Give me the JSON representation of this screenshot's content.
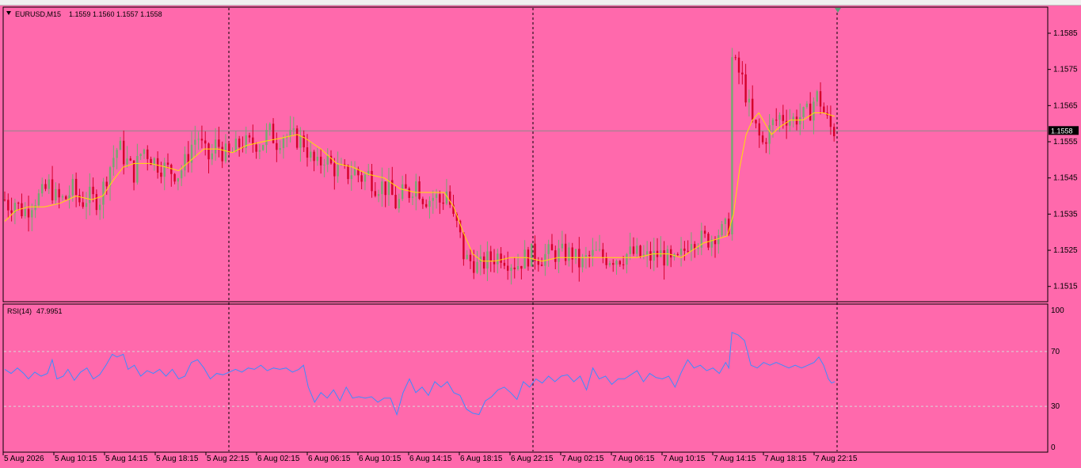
{
  "header": {
    "symbol_label": "EURUSD,M15",
    "ohlc_label": "1.1559 1.1560 1.1557 1.1558",
    "menu_arrow_icon": "triangle-down-icon"
  },
  "colors": {
    "background": "#ff69ac",
    "bull": "#74a970",
    "bear": "#d4002a",
    "ma": "#ffe100",
    "rsi": "#3d8bff",
    "grid": "#000000",
    "bid_line": "#8a8a8a",
    "bid_label_bg": "#000000",
    "bid_label_text": "#ffffff"
  },
  "chart_data": [
    {
      "type": "candlestick",
      "symbol": "EURUSD",
      "timeframe": "M15",
      "ohlc_current": {
        "open": 1.1559,
        "high": 1.156,
        "low": 1.1557,
        "close": 1.1558
      },
      "current_price_label": "1.1558",
      "ylim": [
        1.1511,
        1.1592
      ],
      "y_ticks": [
        "1.1585",
        "1.1575",
        "1.1565",
        "1.1555",
        "1.1545",
        "1.1535",
        "1.1525",
        "1.1515"
      ],
      "close_trace": [
        [
          0,
          1.1539
        ],
        [
          6,
          1.1537
        ],
        [
          12,
          1.1539
        ],
        [
          20,
          1.1536
        ],
        [
          28,
          1.1536
        ],
        [
          36,
          1.1539
        ],
        [
          46,
          1.154
        ],
        [
          56,
          1.1543
        ],
        [
          66,
          1.1539
        ],
        [
          76,
          1.1539
        ],
        [
          86,
          1.1542
        ],
        [
          96,
          1.1538
        ],
        [
          106,
          1.154
        ],
        [
          112,
          1.1539
        ],
        [
          120,
          1.1539
        ],
        [
          128,
          1.1545
        ],
        [
          136,
          1.155
        ],
        [
          144,
          1.1554
        ],
        [
          150,
          1.1551
        ],
        [
          156,
          1.1549
        ],
        [
          164,
          1.1546
        ],
        [
          170,
          1.1551
        ],
        [
          176,
          1.1553
        ],
        [
          184,
          1.1551
        ],
        [
          192,
          1.1549
        ],
        [
          200,
          1.1548
        ],
        [
          210,
          1.1547
        ],
        [
          220,
          1.1546
        ],
        [
          230,
          1.155
        ],
        [
          236,
          1.1554
        ],
        [
          244,
          1.1557
        ],
        [
          252,
          1.1552
        ],
        [
          260,
          1.155
        ],
        [
          268,
          1.1555
        ],
        [
          276,
          1.1552
        ],
        [
          284,
          1.1551
        ],
        [
          292,
          1.1553
        ],
        [
          300,
          1.1555
        ],
        [
          308,
          1.1554
        ],
        [
          316,
          1.1555
        ],
        [
          324,
          1.1554
        ],
        [
          334,
          1.1558
        ],
        [
          344,
          1.1555
        ],
        [
          352,
          1.1557
        ],
        [
          360,
          1.1556
        ],
        [
          368,
          1.1556
        ],
        [
          378,
          1.1555
        ],
        [
          388,
          1.155
        ],
        [
          396,
          1.1548
        ],
        [
          404,
          1.1551
        ],
        [
          414,
          1.1548
        ],
        [
          422,
          1.1547
        ],
        [
          432,
          1.1546
        ],
        [
          442,
          1.1547
        ],
        [
          452,
          1.1545
        ],
        [
          460,
          1.1546
        ],
        [
          468,
          1.1543
        ],
        [
          478,
          1.1543
        ],
        [
          488,
          1.1541
        ],
        [
          496,
          1.1537
        ],
        [
          504,
          1.1541
        ],
        [
          512,
          1.1541
        ],
        [
          520,
          1.1544
        ],
        [
          528,
          1.154
        ],
        [
          536,
          1.1539
        ],
        [
          544,
          1.154
        ],
        [
          552,
          1.1538
        ],
        [
          560,
          1.1542
        ],
        [
          566,
          1.1534
        ],
        [
          574,
          1.1531
        ],
        [
          580,
          1.1524
        ],
        [
          586,
          1.1522
        ],
        [
          592,
          1.1522
        ],
        [
          600,
          1.152
        ],
        [
          608,
          1.1522
        ],
        [
          618,
          1.1523
        ],
        [
          628,
          1.1524
        ],
        [
          638,
          1.1522
        ],
        [
          648,
          1.1521
        ],
        [
          658,
          1.1523
        ],
        [
          668,
          1.1524
        ],
        [
          678,
          1.1523
        ],
        [
          688,
          1.1524
        ],
        [
          698,
          1.1524
        ],
        [
          708,
          1.1524
        ],
        [
          718,
          1.1524
        ],
        [
          728,
          1.1521
        ],
        [
          738,
          1.1523
        ],
        [
          748,
          1.1524
        ],
        [
          758,
          1.1523
        ],
        [
          768,
          1.1523
        ],
        [
          778,
          1.1523
        ],
        [
          788,
          1.1524
        ],
        [
          798,
          1.1524
        ],
        [
          808,
          1.1523
        ],
        [
          818,
          1.1523
        ],
        [
          828,
          1.1524
        ],
        [
          836,
          1.1523
        ],
        [
          844,
          1.1521
        ],
        [
          852,
          1.1522
        ],
        [
          860,
          1.1525
        ],
        [
          868,
          1.1529
        ],
        [
          876,
          1.1528
        ],
        [
          884,
          1.1528
        ],
        [
          892,
          1.1528
        ],
        [
          900,
          1.153
        ],
        [
          908,
          1.153
        ],
        [
          916,
          1.1532
        ],
        [
          920,
          1.1578
        ],
        [
          926,
          1.1575
        ],
        [
          932,
          1.1573
        ],
        [
          940,
          1.1566
        ],
        [
          946,
          1.156
        ],
        [
          952,
          1.1558
        ],
        [
          958,
          1.1554
        ],
        [
          964,
          1.1557
        ],
        [
          972,
          1.156
        ],
        [
          980,
          1.1562
        ],
        [
          988,
          1.1562
        ],
        [
          996,
          1.1561
        ],
        [
          1004,
          1.1562
        ],
        [
          1012,
          1.1562
        ],
        [
          1020,
          1.1564
        ],
        [
          1026,
          1.1568
        ],
        [
          1032,
          1.1566
        ],
        [
          1038,
          1.1562
        ],
        [
          1044,
          1.1559
        ],
        [
          1050,
          1.1558
        ]
      ],
      "ma_trace": [
        [
          0,
          1.1533
        ],
        [
          14,
          1.1536
        ],
        [
          30,
          1.1537
        ],
        [
          50,
          1.1537
        ],
        [
          70,
          1.1538
        ],
        [
          90,
          1.154
        ],
        [
          110,
          1.1539
        ],
        [
          124,
          1.154
        ],
        [
          136,
          1.1544
        ],
        [
          150,
          1.1548
        ],
        [
          164,
          1.1549
        ],
        [
          184,
          1.1549
        ],
        [
          204,
          1.1548
        ],
        [
          220,
          1.1547
        ],
        [
          236,
          1.155
        ],
        [
          252,
          1.1553
        ],
        [
          270,
          1.1553
        ],
        [
          288,
          1.1552
        ],
        [
          306,
          1.1554
        ],
        [
          326,
          1.1555
        ],
        [
          350,
          1.1556
        ],
        [
          370,
          1.1557
        ],
        [
          380,
          1.1556
        ],
        [
          400,
          1.1553
        ],
        [
          420,
          1.1549
        ],
        [
          440,
          1.1548
        ],
        [
          460,
          1.1546
        ],
        [
          480,
          1.1545
        ],
        [
          500,
          1.1542
        ],
        [
          520,
          1.1541
        ],
        [
          540,
          1.1541
        ],
        [
          556,
          1.1541
        ],
        [
          568,
          1.1537
        ],
        [
          580,
          1.153
        ],
        [
          592,
          1.1524
        ],
        [
          604,
          1.1522
        ],
        [
          620,
          1.1522
        ],
        [
          640,
          1.1523
        ],
        [
          660,
          1.1523
        ],
        [
          680,
          1.1522
        ],
        [
          700,
          1.1523
        ],
        [
          720,
          1.1523
        ],
        [
          740,
          1.1523
        ],
        [
          760,
          1.1523
        ],
        [
          780,
          1.1523
        ],
        [
          800,
          1.1523
        ],
        [
          820,
          1.1524
        ],
        [
          840,
          1.1524
        ],
        [
          856,
          1.1523
        ],
        [
          870,
          1.1525
        ],
        [
          884,
          1.1527
        ],
        [
          900,
          1.1528
        ],
        [
          914,
          1.1529
        ],
        [
          922,
          1.1535
        ],
        [
          930,
          1.1548
        ],
        [
          938,
          1.1557
        ],
        [
          946,
          1.1561
        ],
        [
          954,
          1.1563
        ],
        [
          962,
          1.156
        ],
        [
          970,
          1.1557
        ],
        [
          980,
          1.1559
        ],
        [
          994,
          1.1561
        ],
        [
          1010,
          1.1561
        ],
        [
          1024,
          1.1563
        ],
        [
          1036,
          1.1563
        ],
        [
          1050,
          1.1562
        ]
      ],
      "x_ticks": [
        "5 Aug 2026",
        "5 Aug 10:15",
        "5 Aug 14:15",
        "5 Aug 18:15",
        "5 Aug 22:15",
        "6 Aug 02:15",
        "6 Aug 06:15",
        "6 Aug 10:15",
        "6 Aug 14:15",
        "6 Aug 18:15",
        "6 Aug 22:15",
        "7 Aug 02:15",
        "7 Aug 06:15",
        "7 Aug 10:15",
        "7 Aug 14:15",
        "7 Aug 18:15",
        "7 Aug 22:15"
      ],
      "grid": "period-separators"
    },
    {
      "type": "line",
      "indicator": "RSI",
      "label": "RSI(14)",
      "value_label": "47.9951",
      "ylim": [
        0,
        100
      ],
      "y_ticks": [
        "100",
        "70",
        "30",
        "0"
      ],
      "levels": [
        70,
        30
      ],
      "trace": [
        [
          0,
          57
        ],
        [
          8,
          54
        ],
        [
          16,
          58
        ],
        [
          24,
          54
        ],
        [
          30,
          50
        ],
        [
          38,
          55
        ],
        [
          46,
          52
        ],
        [
          54,
          54
        ],
        [
          60,
          64
        ],
        [
          66,
          50
        ],
        [
          74,
          52
        ],
        [
          80,
          57
        ],
        [
          88,
          49
        ],
        [
          96,
          55
        ],
        [
          104,
          58
        ],
        [
          112,
          50
        ],
        [
          120,
          53
        ],
        [
          128,
          60
        ],
        [
          136,
          68
        ],
        [
          142,
          66
        ],
        [
          150,
          68
        ],
        [
          156,
          57
        ],
        [
          164,
          60
        ],
        [
          172,
          52
        ],
        [
          180,
          56
        ],
        [
          188,
          54
        ],
        [
          196,
          57
        ],
        [
          204,
          52
        ],
        [
          212,
          57
        ],
        [
          220,
          50
        ],
        [
          228,
          52
        ],
        [
          236,
          62
        ],
        [
          244,
          64
        ],
        [
          252,
          58
        ],
        [
          260,
          50
        ],
        [
          268,
          54
        ],
        [
          276,
          53
        ],
        [
          284,
          55
        ],
        [
          292,
          57
        ],
        [
          300,
          55
        ],
        [
          308,
          58
        ],
        [
          316,
          57
        ],
        [
          324,
          60
        ],
        [
          332,
          56
        ],
        [
          340,
          58
        ],
        [
          348,
          57
        ],
        [
          356,
          58
        ],
        [
          364,
          55
        ],
        [
          372,
          57
        ],
        [
          378,
          60
        ],
        [
          384,
          44
        ],
        [
          392,
          33
        ],
        [
          400,
          40
        ],
        [
          408,
          36
        ],
        [
          416,
          42
        ],
        [
          424,
          34
        ],
        [
          432,
          44
        ],
        [
          440,
          36
        ],
        [
          448,
          37
        ],
        [
          456,
          36
        ],
        [
          464,
          37
        ],
        [
          472,
          33
        ],
        [
          480,
          36
        ],
        [
          488,
          36
        ],
        [
          496,
          24
        ],
        [
          504,
          40
        ],
        [
          512,
          50
        ],
        [
          520,
          40
        ],
        [
          528,
          44
        ],
        [
          536,
          38
        ],
        [
          544,
          48
        ],
        [
          552,
          44
        ],
        [
          560,
          48
        ],
        [
          568,
          40
        ],
        [
          576,
          38
        ],
        [
          584,
          28
        ],
        [
          592,
          25
        ],
        [
          600,
          24
        ],
        [
          608,
          34
        ],
        [
          616,
          37
        ],
        [
          624,
          42
        ],
        [
          632,
          44
        ],
        [
          640,
          40
        ],
        [
          648,
          35
        ],
        [
          656,
          48
        ],
        [
          664,
          44
        ],
        [
          672,
          50
        ],
        [
          680,
          47
        ],
        [
          688,
          52
        ],
        [
          696,
          48
        ],
        [
          704,
          52
        ],
        [
          712,
          53
        ],
        [
          720,
          48
        ],
        [
          728,
          52
        ],
        [
          736,
          42
        ],
        [
          744,
          58
        ],
        [
          752,
          50
        ],
        [
          760,
          52
        ],
        [
          768,
          46
        ],
        [
          776,
          50
        ],
        [
          784,
          50
        ],
        [
          792,
          53
        ],
        [
          800,
          56
        ],
        [
          808,
          48
        ],
        [
          816,
          54
        ],
        [
          824,
          51
        ],
        [
          832,
          50
        ],
        [
          840,
          52
        ],
        [
          848,
          44
        ],
        [
          856,
          55
        ],
        [
          864,
          64
        ],
        [
          872,
          58
        ],
        [
          880,
          60
        ],
        [
          888,
          56
        ],
        [
          896,
          58
        ],
        [
          904,
          54
        ],
        [
          912,
          62
        ],
        [
          916,
          58
        ],
        [
          920,
          84
        ],
        [
          928,
          82
        ],
        [
          936,
          78
        ],
        [
          944,
          60
        ],
        [
          952,
          58
        ],
        [
          960,
          62
        ],
        [
          968,
          60
        ],
        [
          976,
          62
        ],
        [
          984,
          60
        ],
        [
          992,
          58
        ],
        [
          1000,
          60
        ],
        [
          1008,
          58
        ],
        [
          1016,
          60
        ],
        [
          1024,
          62
        ],
        [
          1030,
          66
        ],
        [
          1036,
          60
        ],
        [
          1042,
          50
        ],
        [
          1046,
          47
        ],
        [
          1050,
          48
        ]
      ]
    }
  ]
}
